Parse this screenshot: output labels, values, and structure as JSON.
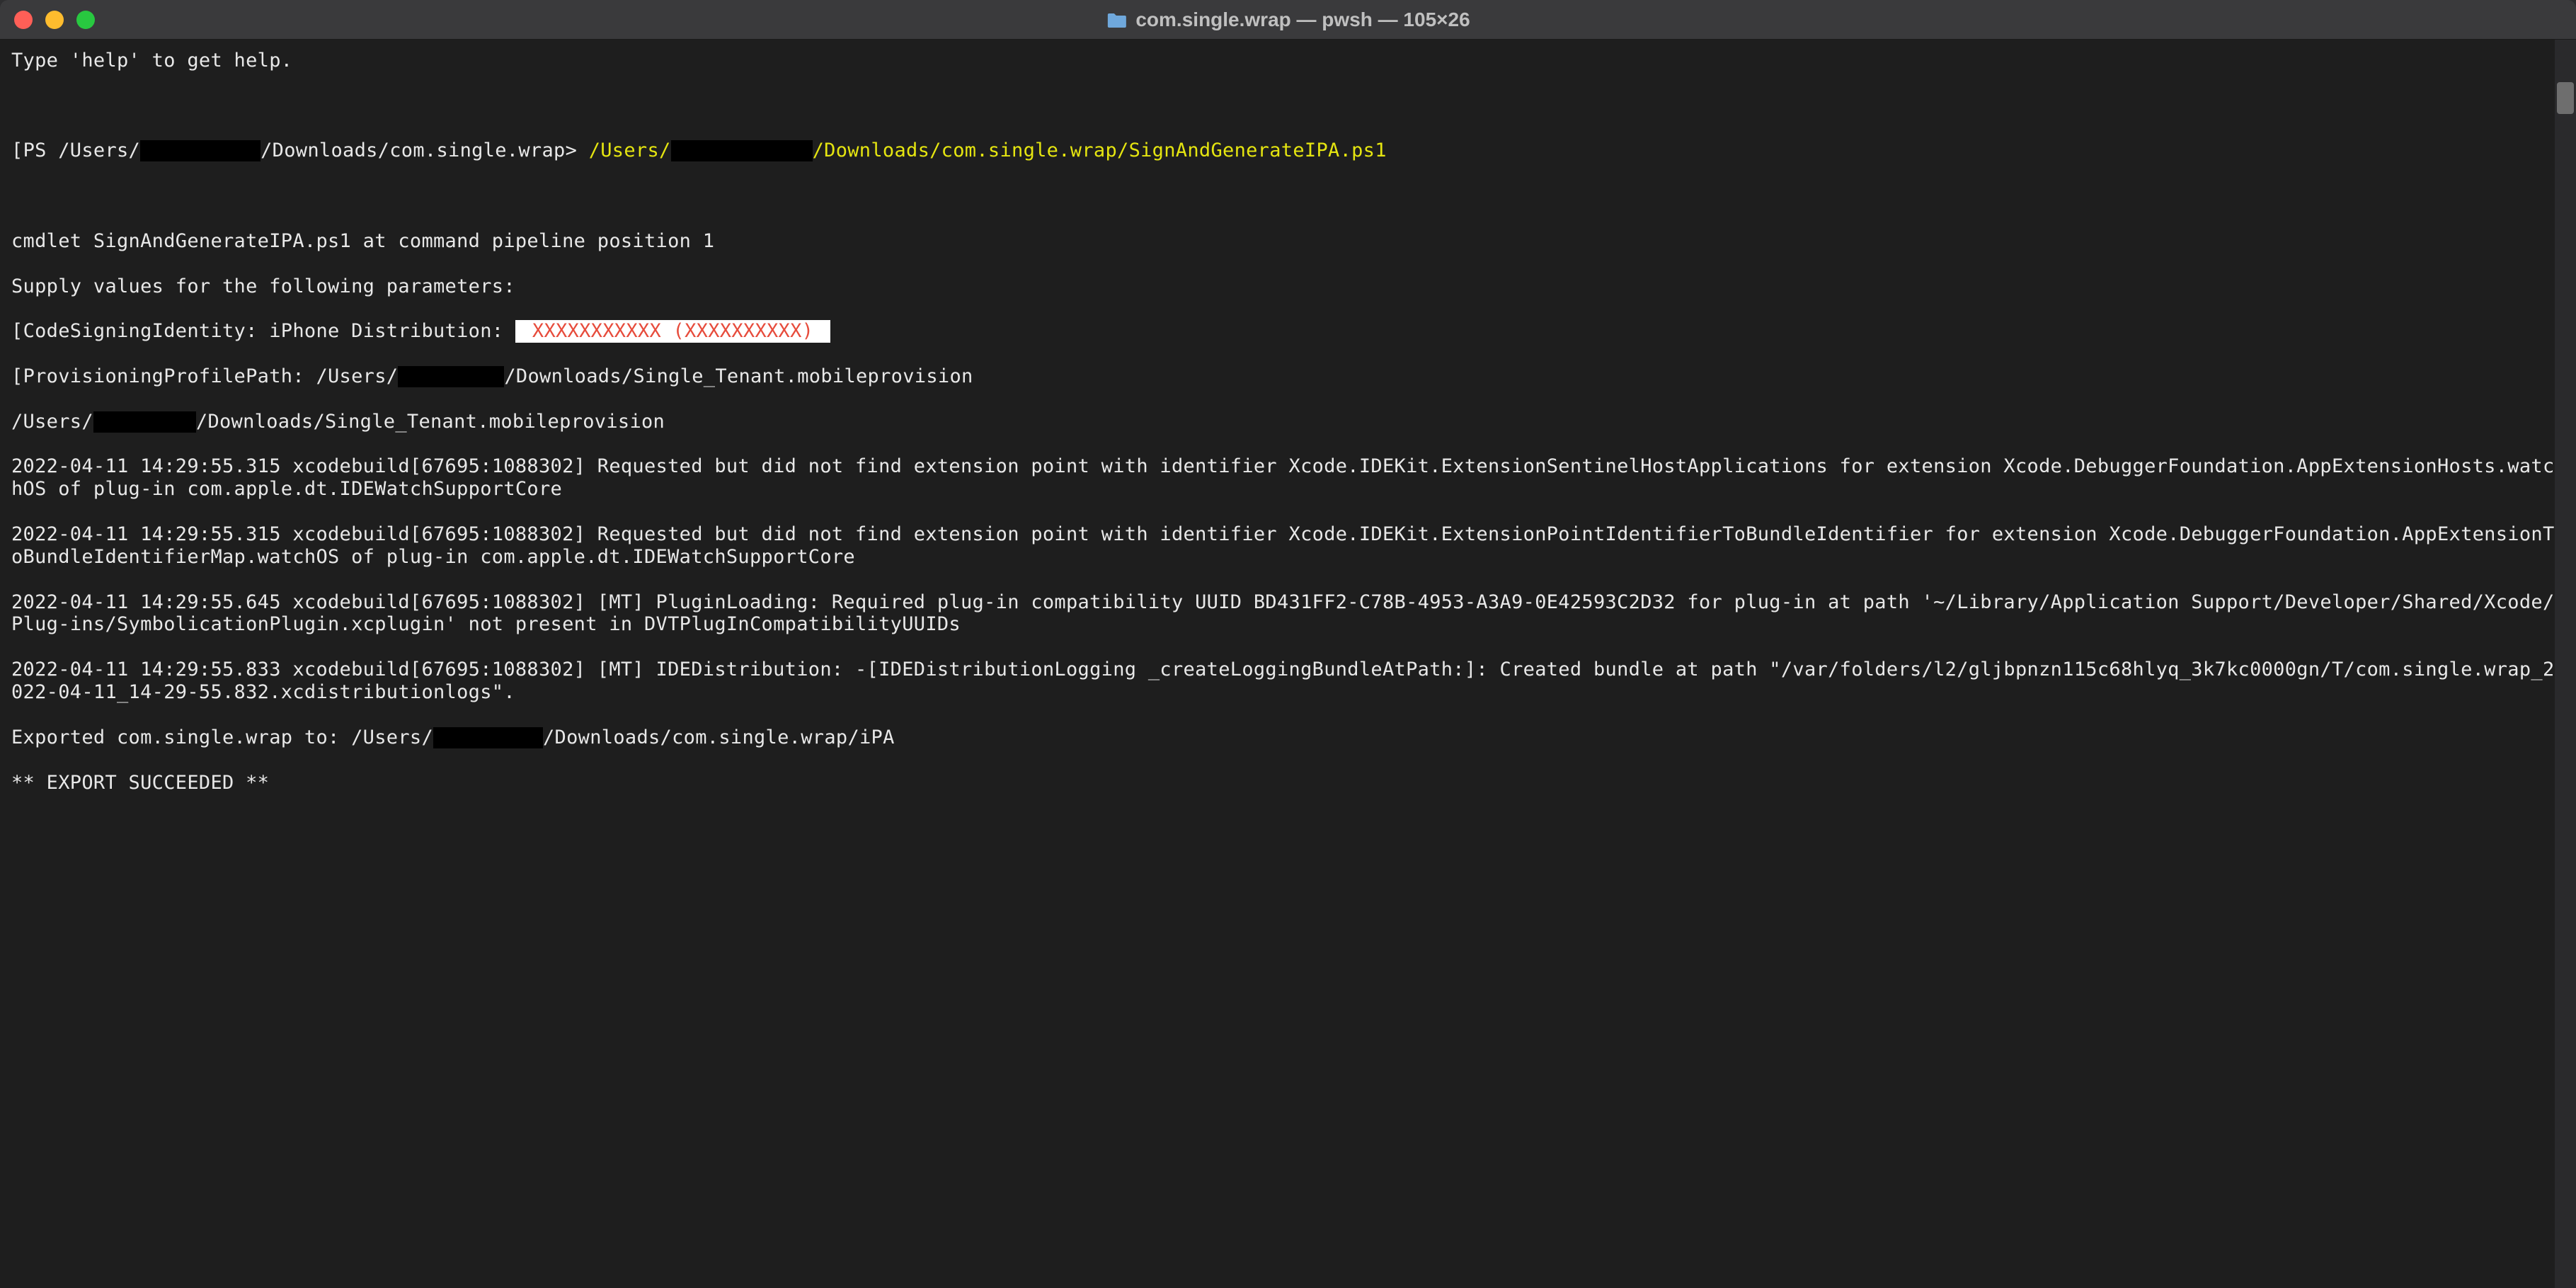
{
  "titlebar": {
    "label": "com.single.wrap — pwsh — 105×26"
  },
  "terminal": {
    "help_line": "Type 'help' to get help.",
    "prompt_pre": "PS /Users/",
    "prompt_post": "/Downloads/com.single.wrap> ",
    "cmd_pre": "/Users/",
    "cmd_post": "/Downloads/com.single.wrap/SignAndGenerateIPA.ps1",
    "cmdlet_line": "cmdlet SignAndGenerateIPA.ps1 at command pipeline position 1",
    "supply_line": "Supply values for the following parameters:",
    "csi_label": "CodeSigningIdentity: iPhone Distribution: ",
    "csi_mask": "XXXXXXXXXXX (XXXXXXXXXX)",
    "ppp_pre": "ProvisioningProfilePath: /Users/",
    "ppp_post": "/Downloads/Single_Tenant.mobileprovision",
    "echo_pre": "/Users/",
    "echo_post": "/Downloads/Single_Tenant.mobileprovision",
    "log1": "2022-04-11 14:29:55.315 xcodebuild[67695:1088302] Requested but did not find extension point with identifier Xcode.IDEKit.ExtensionSentinelHostApplications for extension Xcode.DebuggerFoundation.AppExtensionHosts.watchOS of plug-in com.apple.dt.IDEWatchSupportCore",
    "log2": "2022-04-11 14:29:55.315 xcodebuild[67695:1088302] Requested but did not find extension point with identifier Xcode.IDEKit.ExtensionPointIdentifierToBundleIdentifier for extension Xcode.DebuggerFoundation.AppExtensionToBundleIdentifierMap.watchOS of plug-in com.apple.dt.IDEWatchSupportCore",
    "log3": "2022-04-11 14:29:55.645 xcodebuild[67695:1088302] [MT] PluginLoading: Required plug-in compatibility UUID BD431FF2-C78B-4953-A3A9-0E42593C2D32 for plug-in at path '~/Library/Application Support/Developer/Shared/Xcode/Plug-ins/SymbolicationPlugin.xcplugin' not present in DVTPlugInCompatibilityUUIDs",
    "log4": "2022-04-11 14:29:55.833 xcodebuild[67695:1088302] [MT] IDEDistribution: -[IDEDistributionLogging _createLoggingBundleAtPath:]: Created bundle at path \"/var/folders/l2/gljbpnzn115c68hlyq_3k7kc0000gn/T/com.single.wrap_2022-04-11_14-29-55.832.xcdistributionlogs\".",
    "export_pre": "Exported com.single.wrap to: /Users/",
    "export_post": "/Downloads/com.single.wrap/iPA",
    "succeeded": "** EXPORT SUCCEEDED **"
  }
}
